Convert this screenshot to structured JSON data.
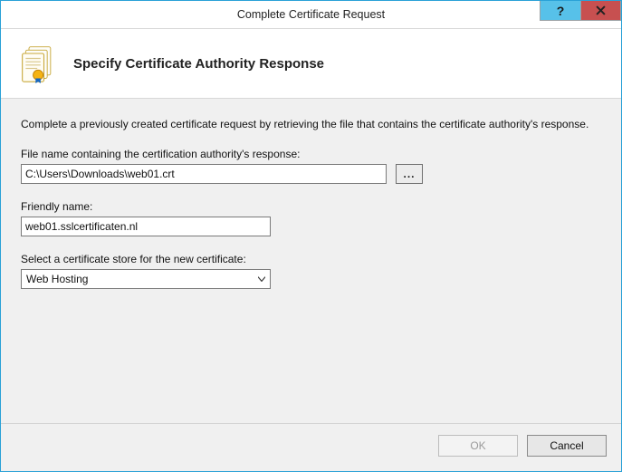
{
  "window": {
    "title": "Complete Certificate Request",
    "help_label": "?",
    "close_label": "X"
  },
  "header": {
    "heading": "Specify Certificate Authority Response"
  },
  "body": {
    "description": "Complete a previously created certificate request by retrieving the file that contains the certificate authority's response.",
    "file_label": "File name containing the certification authority's response:",
    "file_value": "C:\\Users\\Downloads\\web01.crt",
    "browse_label": "...",
    "friendly_label": "Friendly name:",
    "friendly_value": "web01.sslcertificaten.nl",
    "store_label": "Select a certificate store for the new certificate:",
    "store_value": "Web Hosting"
  },
  "footer": {
    "ok": "OK",
    "cancel": "Cancel"
  }
}
